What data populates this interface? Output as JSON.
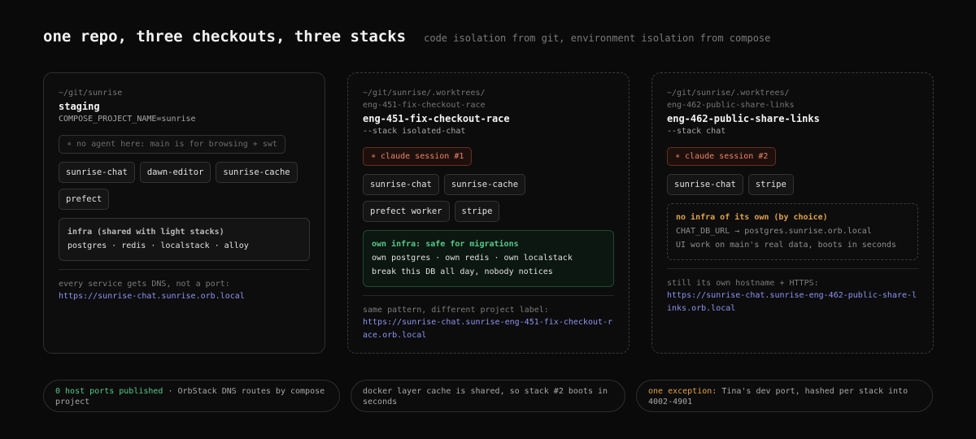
{
  "header": {
    "title": "one repo, three checkouts, three stacks",
    "subtitle": "code isolation from git, environment isolation from compose"
  },
  "cards": {
    "staging": {
      "path": "~/git/sunrise",
      "name": "staging",
      "meta": "COMPOSE_PROJECT_NAME=sunrise",
      "note": "∗ no agent here: main is for browsing + swt",
      "chips": [
        "sunrise-chat",
        "dawn-editor",
        "sunrise-cache",
        "prefect"
      ],
      "infra_title": "infra (shared with light stacks)",
      "infra_line": "postgres · redis · localstack · alloy",
      "foot_label": "every service gets DNS, not a port:",
      "foot_url": "https://sunrise-chat.sunrise.orb.local"
    },
    "eng451": {
      "path_1": "~/git/sunrise/.worktrees/",
      "path_2": "eng-451-fix-checkout-race",
      "name": "eng-451-fix-checkout-race",
      "meta": "--stack isolated-chat",
      "session": "∗ claude session #1",
      "chips": [
        "sunrise-chat",
        "sunrise-cache",
        "prefect worker",
        "stripe"
      ],
      "infra_title": "own infra: safe for migrations",
      "infra_line_1": "own postgres · own redis · own localstack",
      "infra_line_2": "break this DB all day, nobody notices",
      "foot_label": "same pattern, different project label:",
      "foot_url": "https://sunrise-chat.sunrise-eng-451-fix-checkout-race.orb.local"
    },
    "eng462": {
      "path_1": "~/git/sunrise/.worktrees/",
      "path_2": "eng-462-public-share-links",
      "name": "eng-462-public-share-links",
      "meta": "--stack chat",
      "session": "∗ claude session #2",
      "chips": [
        "sunrise-chat",
        "stripe"
      ],
      "infra_title": "no infra of its own (by choice)",
      "infra_line_1": "CHAT_DB_URL → postgres.sunrise.orb.local",
      "infra_line_2": "UI work on main's real data, boots in seconds",
      "foot_label": "still its own hostname + HTTPS:",
      "foot_url": "https://sunrise-chat.sunrise-eng-462-public-share-links.orb.local"
    }
  },
  "footer": {
    "ports_highlight": "0 host ports published",
    "ports_rest": " · OrbStack DNS routes by compose project",
    "cache": "docker layer cache is shared, so stack #2 boots in seconds",
    "exception_highlight": "one exception:",
    "exception_rest": " Tina's dev port, hashed per stack into 4002-4901"
  }
}
